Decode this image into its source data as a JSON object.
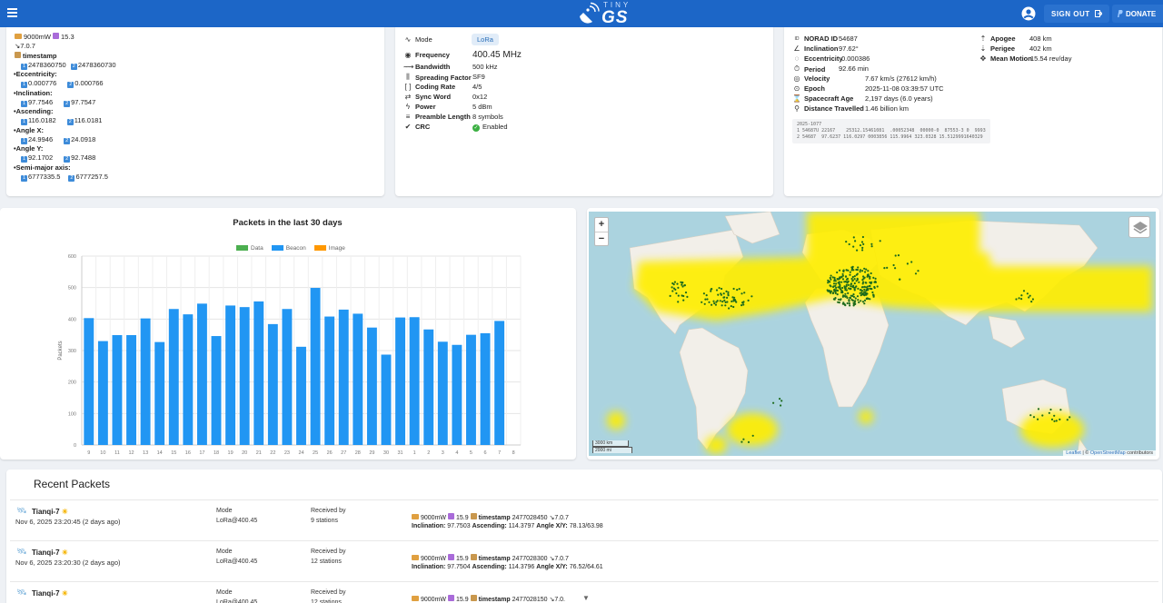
{
  "header": {
    "logo_top": "TINY",
    "logo_word": "GS",
    "signout_label": "SIGN OUT",
    "donate_label": "DONATE"
  },
  "left_card": {
    "power_line": "9000mW",
    "power_extra": "15.3",
    "version": "7.0.7",
    "timestamp_label": "timestamp",
    "timestamp_1": "2478360750",
    "timestamp_2": "2478360730",
    "params": [
      {
        "label": "Eccentricity:",
        "v1": "0.000776",
        "v2": "0.000766"
      },
      {
        "label": "Inclination:",
        "v1": "97.7546",
        "v2": "97.7547"
      },
      {
        "label": "Ascending:",
        "v1": "116.0182",
        "v2": "116.0181"
      },
      {
        "label": "Angle X:",
        "v1": "24.9946",
        "v2": "24.0918"
      },
      {
        "label": "Angle Y:",
        "v1": "92.1702",
        "v2": "92.7488"
      },
      {
        "label": "Semi-major axis:",
        "v1": "6777335.5",
        "v2": "6777257.5"
      }
    ]
  },
  "radio_card": {
    "mode_label": "Mode",
    "mode_value": "LoRa",
    "frequency_label": "Frequency",
    "frequency_value": "400.45 MHz",
    "rows": [
      {
        "label": "Bandwidth",
        "value": "500 kHz"
      },
      {
        "label": "Spreading Factor",
        "value": "SF9"
      },
      {
        "label": "Coding Rate",
        "value": "4/5"
      },
      {
        "label": "Sync Word",
        "value": "0x12"
      },
      {
        "label": "Power",
        "value": "5 dBm"
      },
      {
        "label": "Preamble Length",
        "value": "8 symbols"
      },
      {
        "label": "CRC",
        "value": "Enabled"
      }
    ]
  },
  "orbit_card": {
    "rows": [
      {
        "label": "NORAD ID",
        "value": "54687"
      },
      {
        "label": "Inclination",
        "value": "97.62°"
      },
      {
        "label": "Eccentricity",
        "value": "0.000386"
      },
      {
        "label": "Period",
        "value": "92.66 min"
      },
      {
        "label": "Velocity",
        "value": "7.67 km/s (27612 km/h)"
      },
      {
        "label": "Epoch",
        "value": "2025-11-08 03:39:57 UTC"
      },
      {
        "label": "Spacecraft Age",
        "value": "2,197 days (6.0 years)"
      },
      {
        "label": "Distance Travelled",
        "value": "1.46 billion km"
      }
    ],
    "right_rows": [
      {
        "label": "Apogee",
        "value": "408 km"
      },
      {
        "label": "Perigee",
        "value": "402 km"
      },
      {
        "label": "Mean Motion",
        "value": "15.54 rev/day"
      }
    ],
    "tle_lines": [
      "2025-1077",
      "1 54687U 22167    25312.15461081  .00052348  00000-0  87553-3 0  9993",
      "2 54687  97.6237 116.0297 0003856 115.9964 323.0328 15.5129991640329"
    ]
  },
  "chart_data": {
    "type": "bar",
    "title": "Packets in the last 30 days",
    "ylabel": "Packets",
    "ylim": [
      0,
      600
    ],
    "yticks": [
      0,
      100,
      200,
      300,
      400,
      500,
      600
    ],
    "legend": [
      {
        "name": "Data",
        "color": "#4caf50"
      },
      {
        "name": "Beacon",
        "color": "#2196f3"
      },
      {
        "name": "Image",
        "color": "#ff9800"
      }
    ],
    "categories": [
      "9",
      "10",
      "11",
      "12",
      "13",
      "14",
      "15",
      "16",
      "17",
      "18",
      "19",
      "20",
      "21",
      "22",
      "23",
      "24",
      "25",
      "26",
      "27",
      "28",
      "29",
      "30",
      "31",
      "1",
      "2",
      "3",
      "4",
      "5",
      "6",
      "7",
      "8"
    ],
    "series": [
      {
        "name": "Beacon",
        "color": "#2196f3",
        "values": [
          403,
          330,
          349,
          349,
          402,
          327,
          432,
          415,
          449,
          346,
          443,
          438,
          456,
          384,
          432,
          312,
          499,
          408,
          430,
          417,
          373,
          287,
          405,
          406,
          367,
          328,
          318,
          350,
          355,
          394,
          0
        ]
      }
    ]
  },
  "map": {
    "zoom_in": "+",
    "zoom_out": "−",
    "scale_km": "3000 km",
    "scale_mi": "2000 mi",
    "attribution_leaflet": "Leaflet",
    "attribution_osm": "OpenStreetMap",
    "attribution_tail": "contributors"
  },
  "recent": {
    "title": "Recent Packets",
    "packets": [
      {
        "satellite": "Tianqi-7",
        "date": "Nov 6, 2025 23:20:45 (2 days ago)",
        "mode_label": "Mode",
        "mode_value": "LoRa@400.45",
        "recv_label": "Received by",
        "recv_value": "9 stations",
        "power": "9000mW",
        "extra": "15.9",
        "ts_label": "timestamp",
        "ts": "2477028450",
        "ver": "7.0.7",
        "incl": "97.7503",
        "asc": "114.3797",
        "angle": "78.13/63.98"
      },
      {
        "satellite": "Tianqi-7",
        "date": "Nov 6, 2025 23:20:30 (2 days ago)",
        "mode_label": "Mode",
        "mode_value": "LoRa@400.45",
        "recv_label": "Received by",
        "recv_value": "12 stations",
        "power": "9000mW",
        "extra": "15.9",
        "ts_label": "timestamp",
        "ts": "2477028300",
        "ver": "7.0.7",
        "incl": "97.7504",
        "asc": "114.3796",
        "angle": "76.52/64.61"
      },
      {
        "satellite": "Tianqi-7",
        "date": "",
        "mode_label": "Mode",
        "mode_value": "LoRa@400.45",
        "recv_label": "Received by",
        "recv_value": "12 stations",
        "power": "9000mW",
        "extra": "15.9",
        "ts_label": "timestamp",
        "ts": "2477028150",
        "ver": "7.0.",
        "incl": "",
        "asc": "",
        "angle": ""
      }
    ],
    "labels": {
      "inclination": "Inclination:",
      "ascending": "Ascending:",
      "anglexy": "Angle X/Y:"
    }
  }
}
